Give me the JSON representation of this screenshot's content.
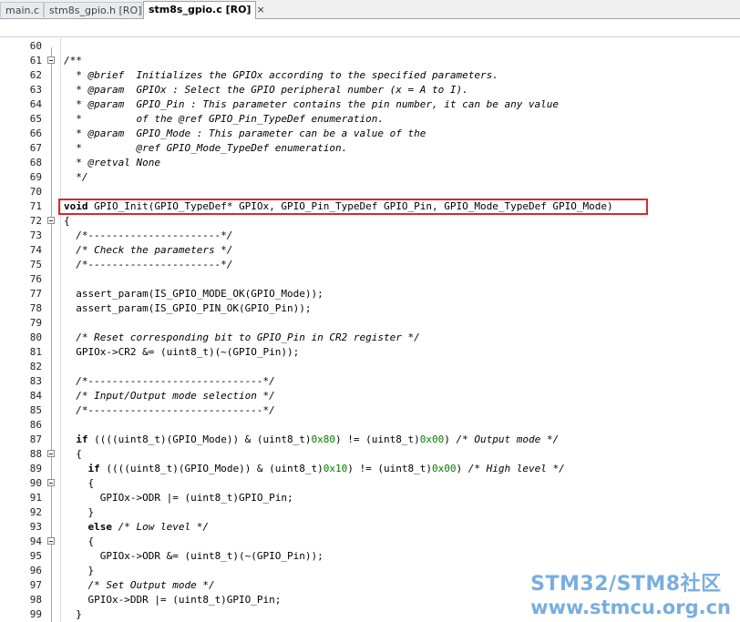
{
  "tabs": [
    {
      "label": "main.c",
      "active": false
    },
    {
      "label": "stm8s_gpio.h [RO]",
      "active": false
    },
    {
      "label": "stm8s_gpio.c [RO]",
      "active": true
    }
  ],
  "close_glyph": "×",
  "colors": {
    "highlight_border": "#d92a2a",
    "number_literal": "#008000",
    "watermark": "#4a93d6"
  },
  "lines": [
    {
      "num": "60",
      "fold": false,
      "text": ""
    },
    {
      "num": "61",
      "fold": true,
      "text": "/**"
    },
    {
      "num": "62",
      "fold": false,
      "text": "  * @brief  Initializes the GPIOx according to the specified parameters."
    },
    {
      "num": "63",
      "fold": false,
      "text": "  * @param  GPIOx : Select the GPIO peripheral number (x = A to I)."
    },
    {
      "num": "64",
      "fold": false,
      "text": "  * @param  GPIO_Pin : This parameter contains the pin number, it can be any value"
    },
    {
      "num": "65",
      "fold": false,
      "text": "  *         of the @ref GPIO_Pin_TypeDef enumeration."
    },
    {
      "num": "66",
      "fold": false,
      "text": "  * @param  GPIO_Mode : This parameter can be a value of the"
    },
    {
      "num": "67",
      "fold": false,
      "text": "  *         @ref GPIO_Mode_TypeDef enumeration."
    },
    {
      "num": "68",
      "fold": false,
      "text": "  * @retval None"
    },
    {
      "num": "69",
      "fold": false,
      "text": "  */"
    },
    {
      "num": "70",
      "fold": false,
      "text": ""
    },
    {
      "num": "71",
      "fold": false,
      "text": "void GPIO_Init(GPIO_TypeDef* GPIOx, GPIO_Pin_TypeDef GPIO_Pin, GPIO_Mode_TypeDef GPIO_Mode)"
    },
    {
      "num": "72",
      "fold": true,
      "text": "{"
    },
    {
      "num": "73",
      "fold": false,
      "text": "  /*----------------------*/"
    },
    {
      "num": "74",
      "fold": false,
      "text": "  /* Check the parameters */"
    },
    {
      "num": "75",
      "fold": false,
      "text": "  /*----------------------*/"
    },
    {
      "num": "76",
      "fold": false,
      "text": ""
    },
    {
      "num": "77",
      "fold": false,
      "text": "  assert_param(IS_GPIO_MODE_OK(GPIO_Mode));"
    },
    {
      "num": "78",
      "fold": false,
      "text": "  assert_param(IS_GPIO_PIN_OK(GPIO_Pin));"
    },
    {
      "num": "79",
      "fold": false,
      "text": ""
    },
    {
      "num": "80",
      "fold": false,
      "text": "  /* Reset corresponding bit to GPIO_Pin in CR2 register */"
    },
    {
      "num": "81",
      "fold": false,
      "text": "  GPIOx->CR2 &= (uint8_t)(~(GPIO_Pin));"
    },
    {
      "num": "82",
      "fold": false,
      "text": ""
    },
    {
      "num": "83",
      "fold": false,
      "text": "  /*-----------------------------*/"
    },
    {
      "num": "84",
      "fold": false,
      "text": "  /* Input/Output mode selection */"
    },
    {
      "num": "85",
      "fold": false,
      "text": "  /*-----------------------------*/"
    },
    {
      "num": "86",
      "fold": false,
      "text": ""
    },
    {
      "num": "87",
      "fold": false,
      "text": "  if ((((uint8_t)(GPIO_Mode)) & (uint8_t)0x80) != (uint8_t)0x00) /* Output mode */"
    },
    {
      "num": "88",
      "fold": true,
      "text": "  {"
    },
    {
      "num": "89",
      "fold": false,
      "text": "    if ((((uint8_t)(GPIO_Mode)) & (uint8_t)0x10) != (uint8_t)0x00) /* High level */"
    },
    {
      "num": "90",
      "fold": true,
      "text": "    {"
    },
    {
      "num": "91",
      "fold": false,
      "text": "      GPIOx->ODR |= (uint8_t)GPIO_Pin;"
    },
    {
      "num": "92",
      "fold": false,
      "text": "    }"
    },
    {
      "num": "93",
      "fold": false,
      "text": "    else /* Low level */"
    },
    {
      "num": "94",
      "fold": true,
      "text": "    {"
    },
    {
      "num": "95",
      "fold": false,
      "text": "      GPIOx->ODR &= (uint8_t)(~(GPIO_Pin));"
    },
    {
      "num": "96",
      "fold": false,
      "text": "    }"
    },
    {
      "num": "97",
      "fold": false,
      "text": "    /* Set Output mode */"
    },
    {
      "num": "98",
      "fold": false,
      "text": "    GPIOx->DDR |= (uint8_t)GPIO_Pin;"
    },
    {
      "num": "99",
      "fold": false,
      "text": "  }"
    }
  ],
  "watermark": {
    "line1": "STM32/STM8社区",
    "line2": "www.stmcu.org.cn"
  }
}
